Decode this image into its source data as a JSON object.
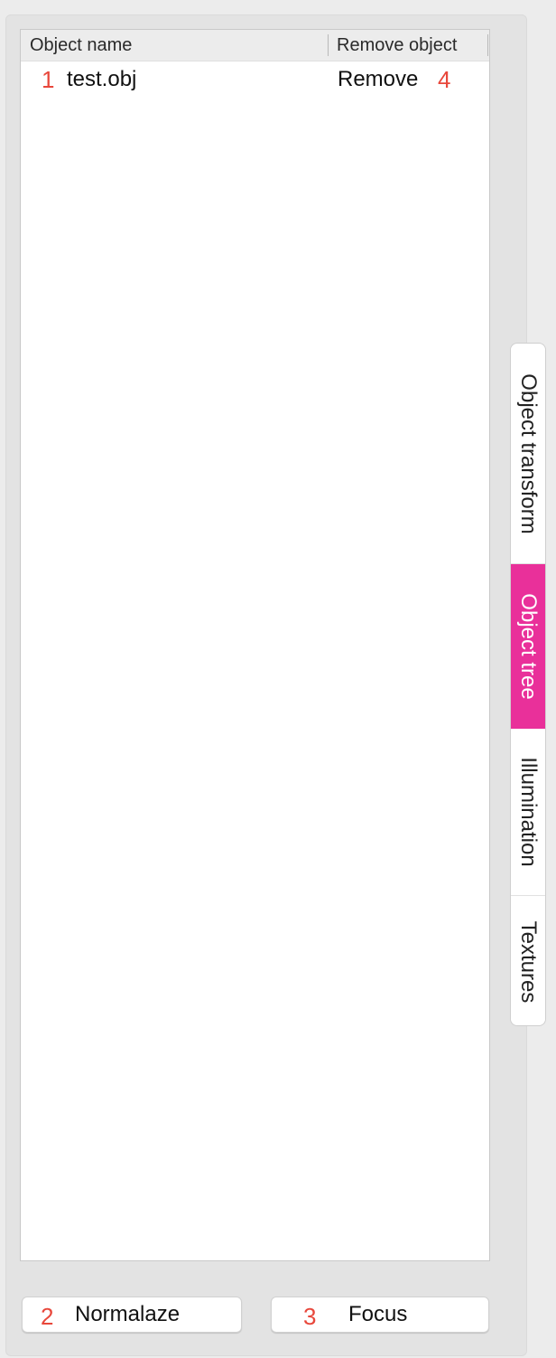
{
  "table": {
    "columns": [
      "Object name",
      "Remove object"
    ],
    "rows": [
      {
        "index": "1",
        "name": "test.obj",
        "action": "Remove",
        "action_index": "4"
      }
    ]
  },
  "buttons": {
    "normalize": {
      "index": "2",
      "label": "Normalaze"
    },
    "focus": {
      "index": "3",
      "label": "Focus"
    }
  },
  "tabs": [
    {
      "label": "Object transform",
      "active": false
    },
    {
      "label": "Object tree",
      "active": true
    },
    {
      "label": "Illumination",
      "active": false
    },
    {
      "label": "Textures",
      "active": false
    }
  ],
  "colors": {
    "active_tab": "#e9309a",
    "annotation_number": "#e8473b"
  }
}
